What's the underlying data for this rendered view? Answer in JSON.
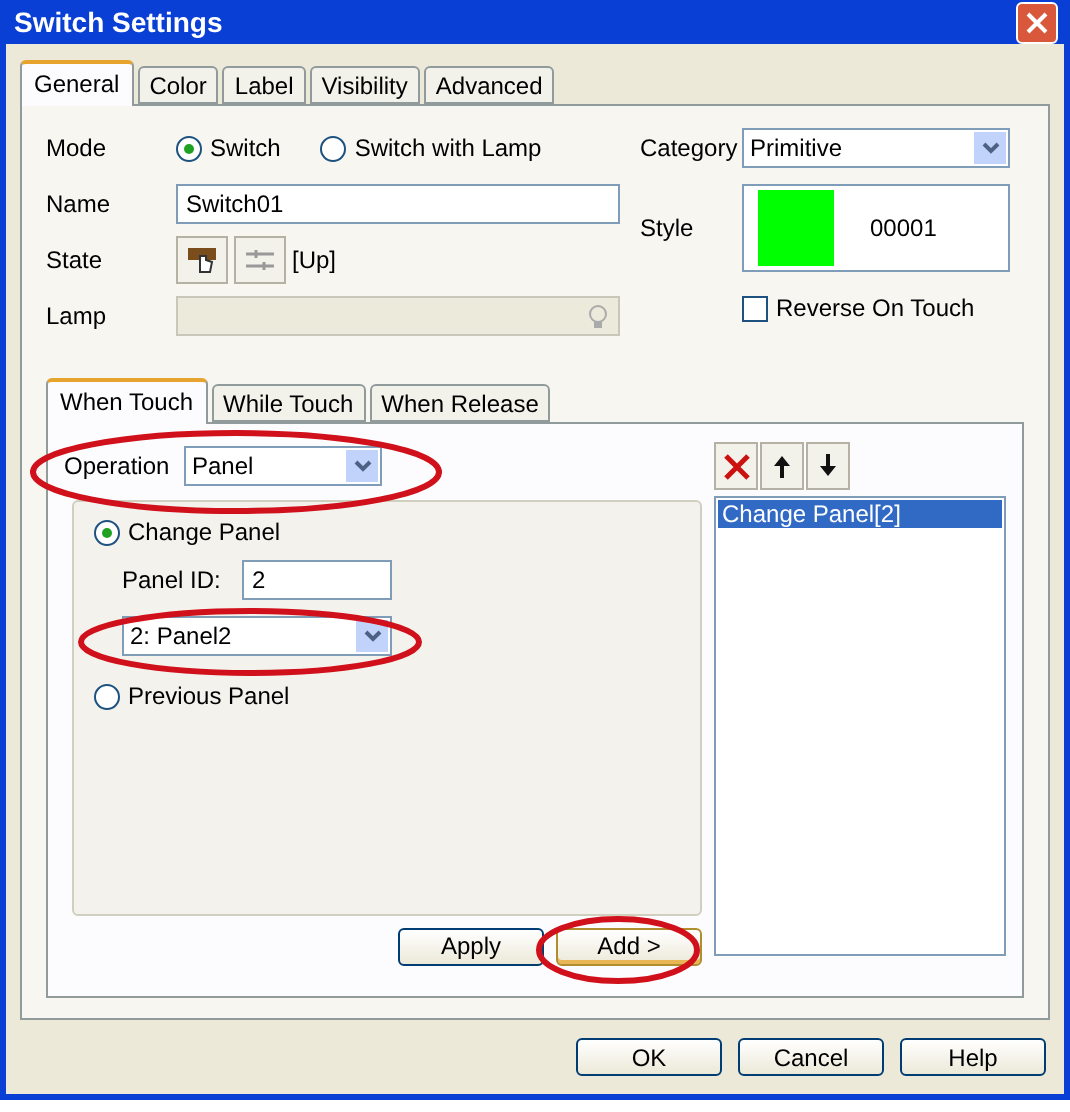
{
  "window": {
    "title": "Switch Settings"
  },
  "tabs": [
    {
      "label": "General",
      "selected": true
    },
    {
      "label": "Color",
      "selected": false
    },
    {
      "label": "Label",
      "selected": false
    },
    {
      "label": "Visibility",
      "selected": false
    },
    {
      "label": "Advanced",
      "selected": false
    }
  ],
  "general": {
    "mode": {
      "label": "Mode",
      "options": [
        {
          "label": "Switch",
          "selected": true
        },
        {
          "label": "Switch with Lamp",
          "selected": false
        }
      ]
    },
    "name": {
      "label": "Name",
      "value": "Switch01"
    },
    "state": {
      "label": "State",
      "value": "[Up]"
    },
    "lamp": {
      "label": "Lamp",
      "disabled": true
    },
    "category": {
      "label": "Category",
      "value": "Primitive"
    },
    "style": {
      "label": "Style",
      "value": "00001"
    },
    "reverse_on_touch": {
      "label": "Reverse On Touch",
      "checked": false
    }
  },
  "action_tabs": [
    {
      "label": "When Touch",
      "selected": true
    },
    {
      "label": "While Touch",
      "selected": false
    },
    {
      "label": "When Release",
      "selected": false
    }
  ],
  "operation": {
    "label": "Operation",
    "value": "Panel"
  },
  "panel_options": [
    {
      "label": "Change Panel",
      "selected": true
    },
    {
      "label": "Previous Panel",
      "selected": false
    }
  ],
  "panel_id": {
    "label": "Panel ID:",
    "value": "2"
  },
  "panel_select": {
    "value": "2: Panel2"
  },
  "action_list": [
    {
      "label": "Change Panel[2]",
      "selected": true
    }
  ],
  "apply": "Apply",
  "add": "Add >",
  "buttons": [
    "OK",
    "Cancel",
    "Help"
  ]
}
